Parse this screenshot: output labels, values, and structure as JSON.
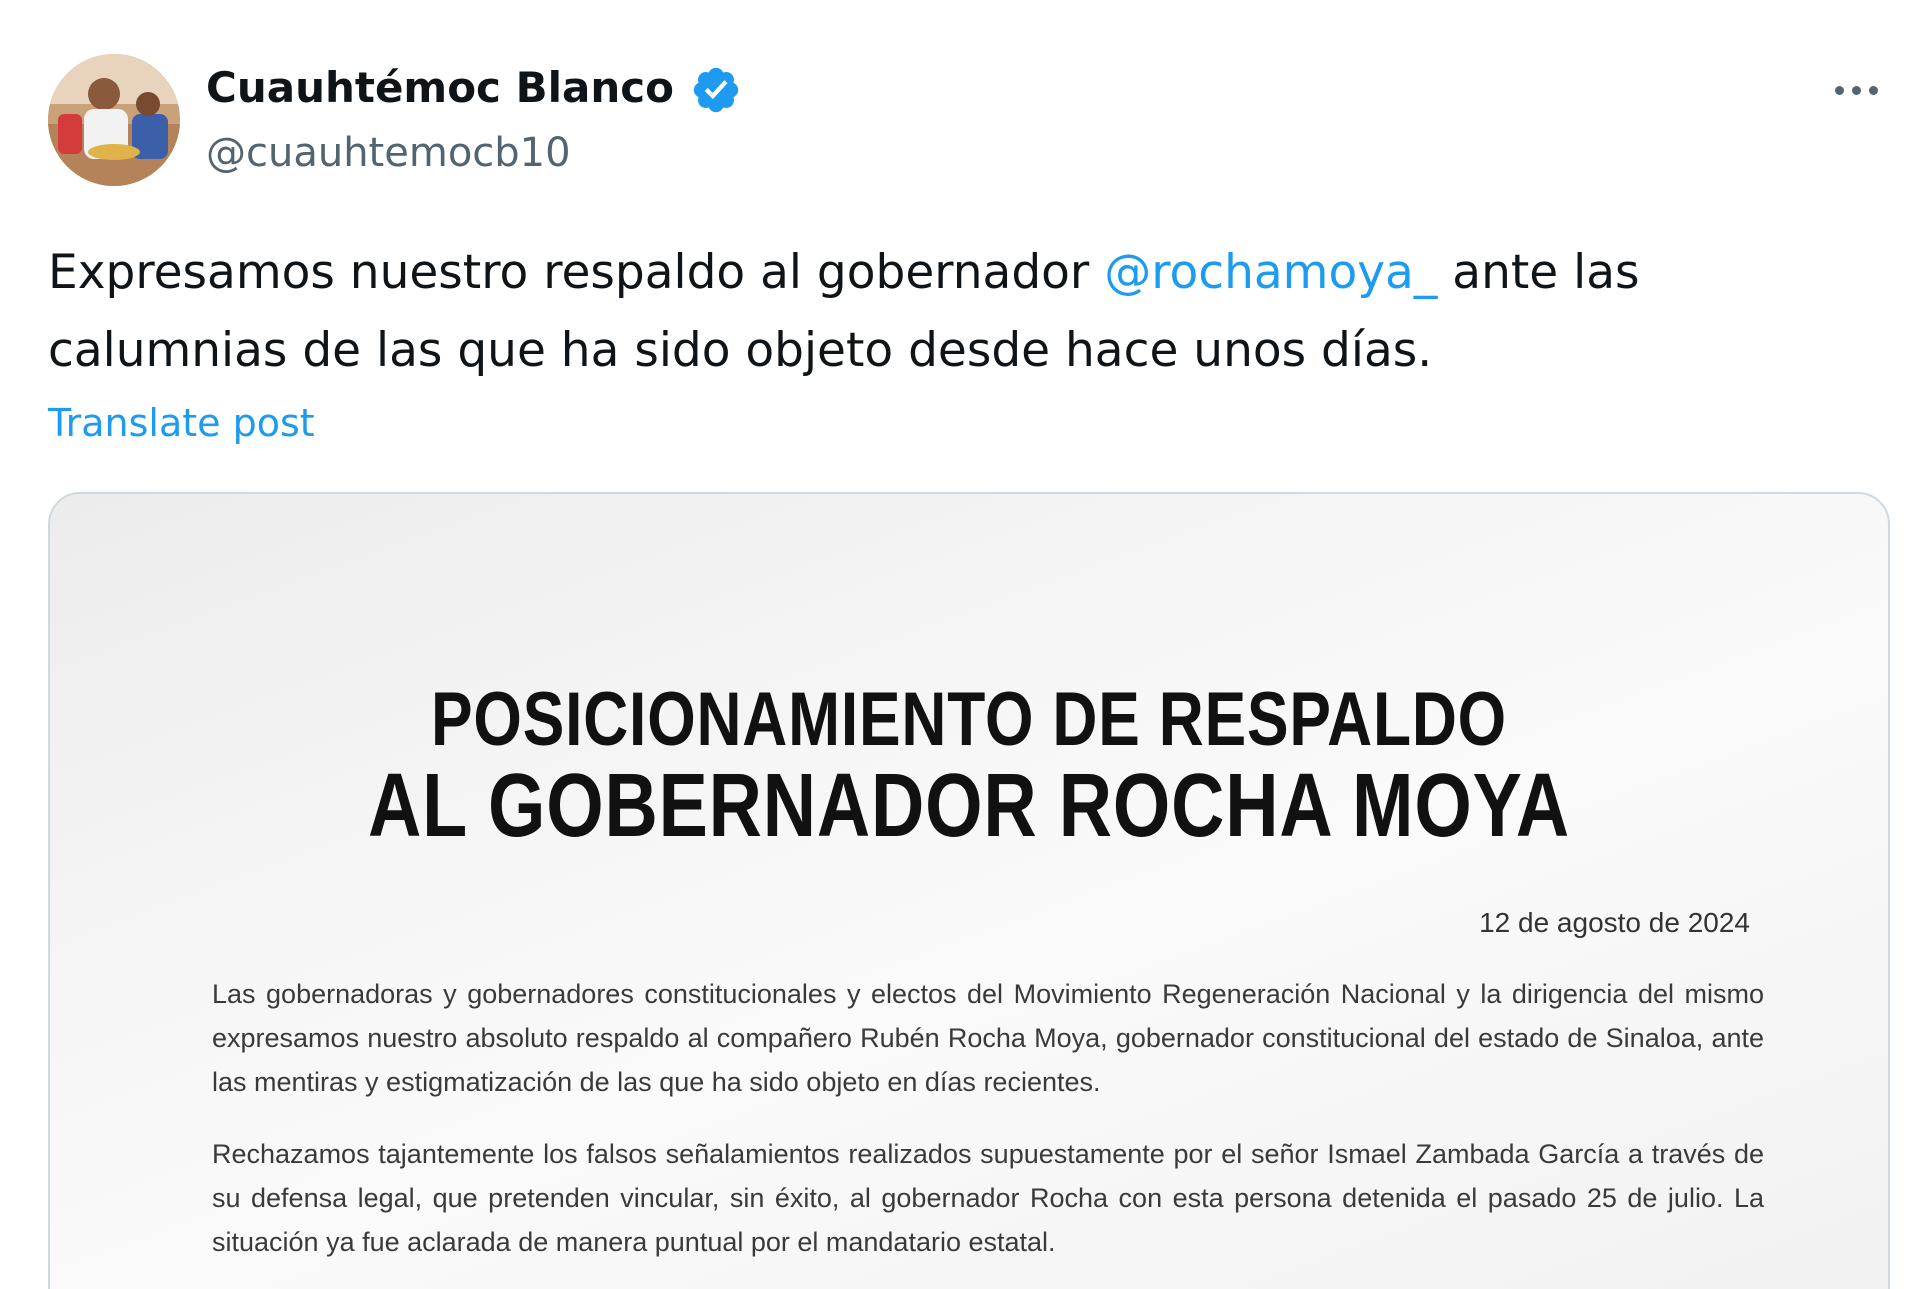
{
  "author": {
    "display_name": "Cuauhtémoc Blanco",
    "handle": "@cuauhtemocb10",
    "verified": true
  },
  "tweet": {
    "text_before": "Expresamos nuestro respaldo al gobernador ",
    "mention": "@rochamoya_",
    "text_after": " ante las calumnias de las que ha sido objeto desde hace unos días.",
    "translate_label": "Translate post"
  },
  "media": {
    "title_line1": "POSICIONAMIENTO DE RESPALDO",
    "title_line2": "AL GOBERNADOR ROCHA MOYA",
    "date": "12 de agosto de 2024",
    "paragraph1": "Las gobernadoras y gobernadores constitucionales y electos del Movimiento Regeneración Nacional y la dirigencia del mismo expresamos nuestro absoluto respaldo al compañero Rubén Rocha Moya, gobernador constitucional del estado de Sinaloa, ante las mentiras y estigmatización de las que ha sido objeto en días recientes.",
    "paragraph2": "Rechazamos tajantemente los falsos señalamientos realizados supuestamente por el señor Ismael Zambada García a través de su defensa legal, que pretenden vincular, sin éxito, al gobernador Rocha con esta persona detenida el pasado 25 de julio. La situación ya fue aclarada de manera puntual por el mandatario estatal."
  },
  "colors": {
    "accent": "#1d9bf0",
    "text": "#0f1419",
    "secondary_text": "#536471",
    "border": "#cfd9de"
  },
  "icons": {
    "verified": "verified-badge-icon",
    "more": "more-horizontal-icon"
  }
}
